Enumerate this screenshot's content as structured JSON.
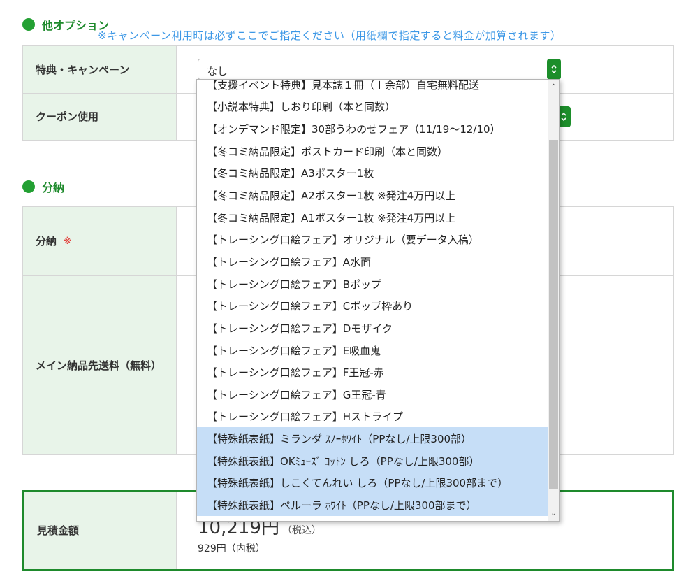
{
  "sections": {
    "other_options": {
      "title": "他オプション",
      "notice": "※キャンペーン利用時は必ずここでご指定ください（用紙欄で指定すると料金が加算されます）"
    },
    "split": {
      "title": "分納"
    }
  },
  "options_table": {
    "campaign_label": "特典・キャンペーン",
    "campaign_value": "なし",
    "coupon_label": "クーポン使用"
  },
  "split_table": {
    "split_label": "分納",
    "required_mark": "※",
    "main_delivery_label": "メイン納品先送料（無料）"
  },
  "estimate": {
    "label": "見積金額",
    "price": "10,219円",
    "tax_note": "（税込）",
    "tax_inner": "929円（内税）"
  },
  "dropdown": {
    "options": [
      "【支援イベント特典】見本誌１冊（＋余部）自宅無料配送",
      "【小説本特典】しおり印刷（本と同数）",
      "【オンデマンド限定】30部うわのせフェア（11/19〜12/10）",
      "【冬コミ納品限定】ポストカード印刷（本と同数）",
      "【冬コミ納品限定】A3ポスター1枚",
      "【冬コミ納品限定】A2ポスター1枚 ※発注4万円以上",
      "【冬コミ納品限定】A1ポスター1枚 ※発注4万円以上",
      "【トレーシング口絵フェア】オリジナル（要データ入稿）",
      "【トレーシング口絵フェア】A水面",
      "【トレーシング口絵フェア】Bポップ",
      "【トレーシング口絵フェア】Cポップ枠あり",
      "【トレーシング口絵フェア】Dモザイク",
      "【トレーシング口絵フェア】E吸血鬼",
      "【トレーシング口絵フェア】F王冠-赤",
      "【トレーシング口絵フェア】G王冠-青",
      "【トレーシング口絵フェア】Hストライプ",
      "【特殊紙表紙】ミランダ ｽﾉｰﾎﾜｲﾄ（PPなし/上限300部）",
      "【特殊紙表紙】OKﾐｭｰｽﾞ ｺｯﾄﾝ しろ（PPなし/上限300部）",
      "【特殊紙表紙】しこくてんれい しろ（PPなし/上限300部まで）",
      "【特殊紙表紙】ペルーラ ﾎﾜｲﾄ（PPなし/上限300部まで）"
    ]
  },
  "colors": {
    "accent": "#1e8a2c",
    "header_bg": "#e8f4e9",
    "notice": "#3b97e6",
    "highlight": "#c6def7"
  }
}
